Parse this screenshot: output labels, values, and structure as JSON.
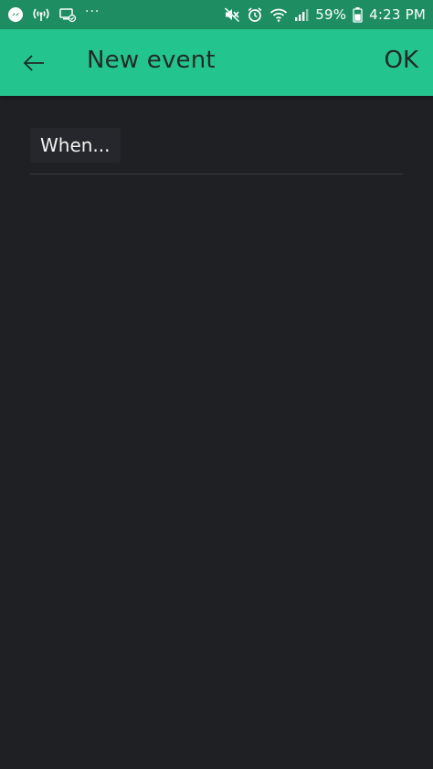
{
  "status_bar": {
    "battery_percent": "59%",
    "time": "4:23 PM",
    "more_indicator": "···"
  },
  "app_bar": {
    "title": "New event",
    "ok_label": "OK"
  },
  "event": {
    "when_label": "When..."
  },
  "colors": {
    "status_bar_bg": "#1e8e62",
    "app_bar_bg": "#23c48e",
    "content_bg": "#1f2024",
    "chip_bg": "#26272c"
  }
}
